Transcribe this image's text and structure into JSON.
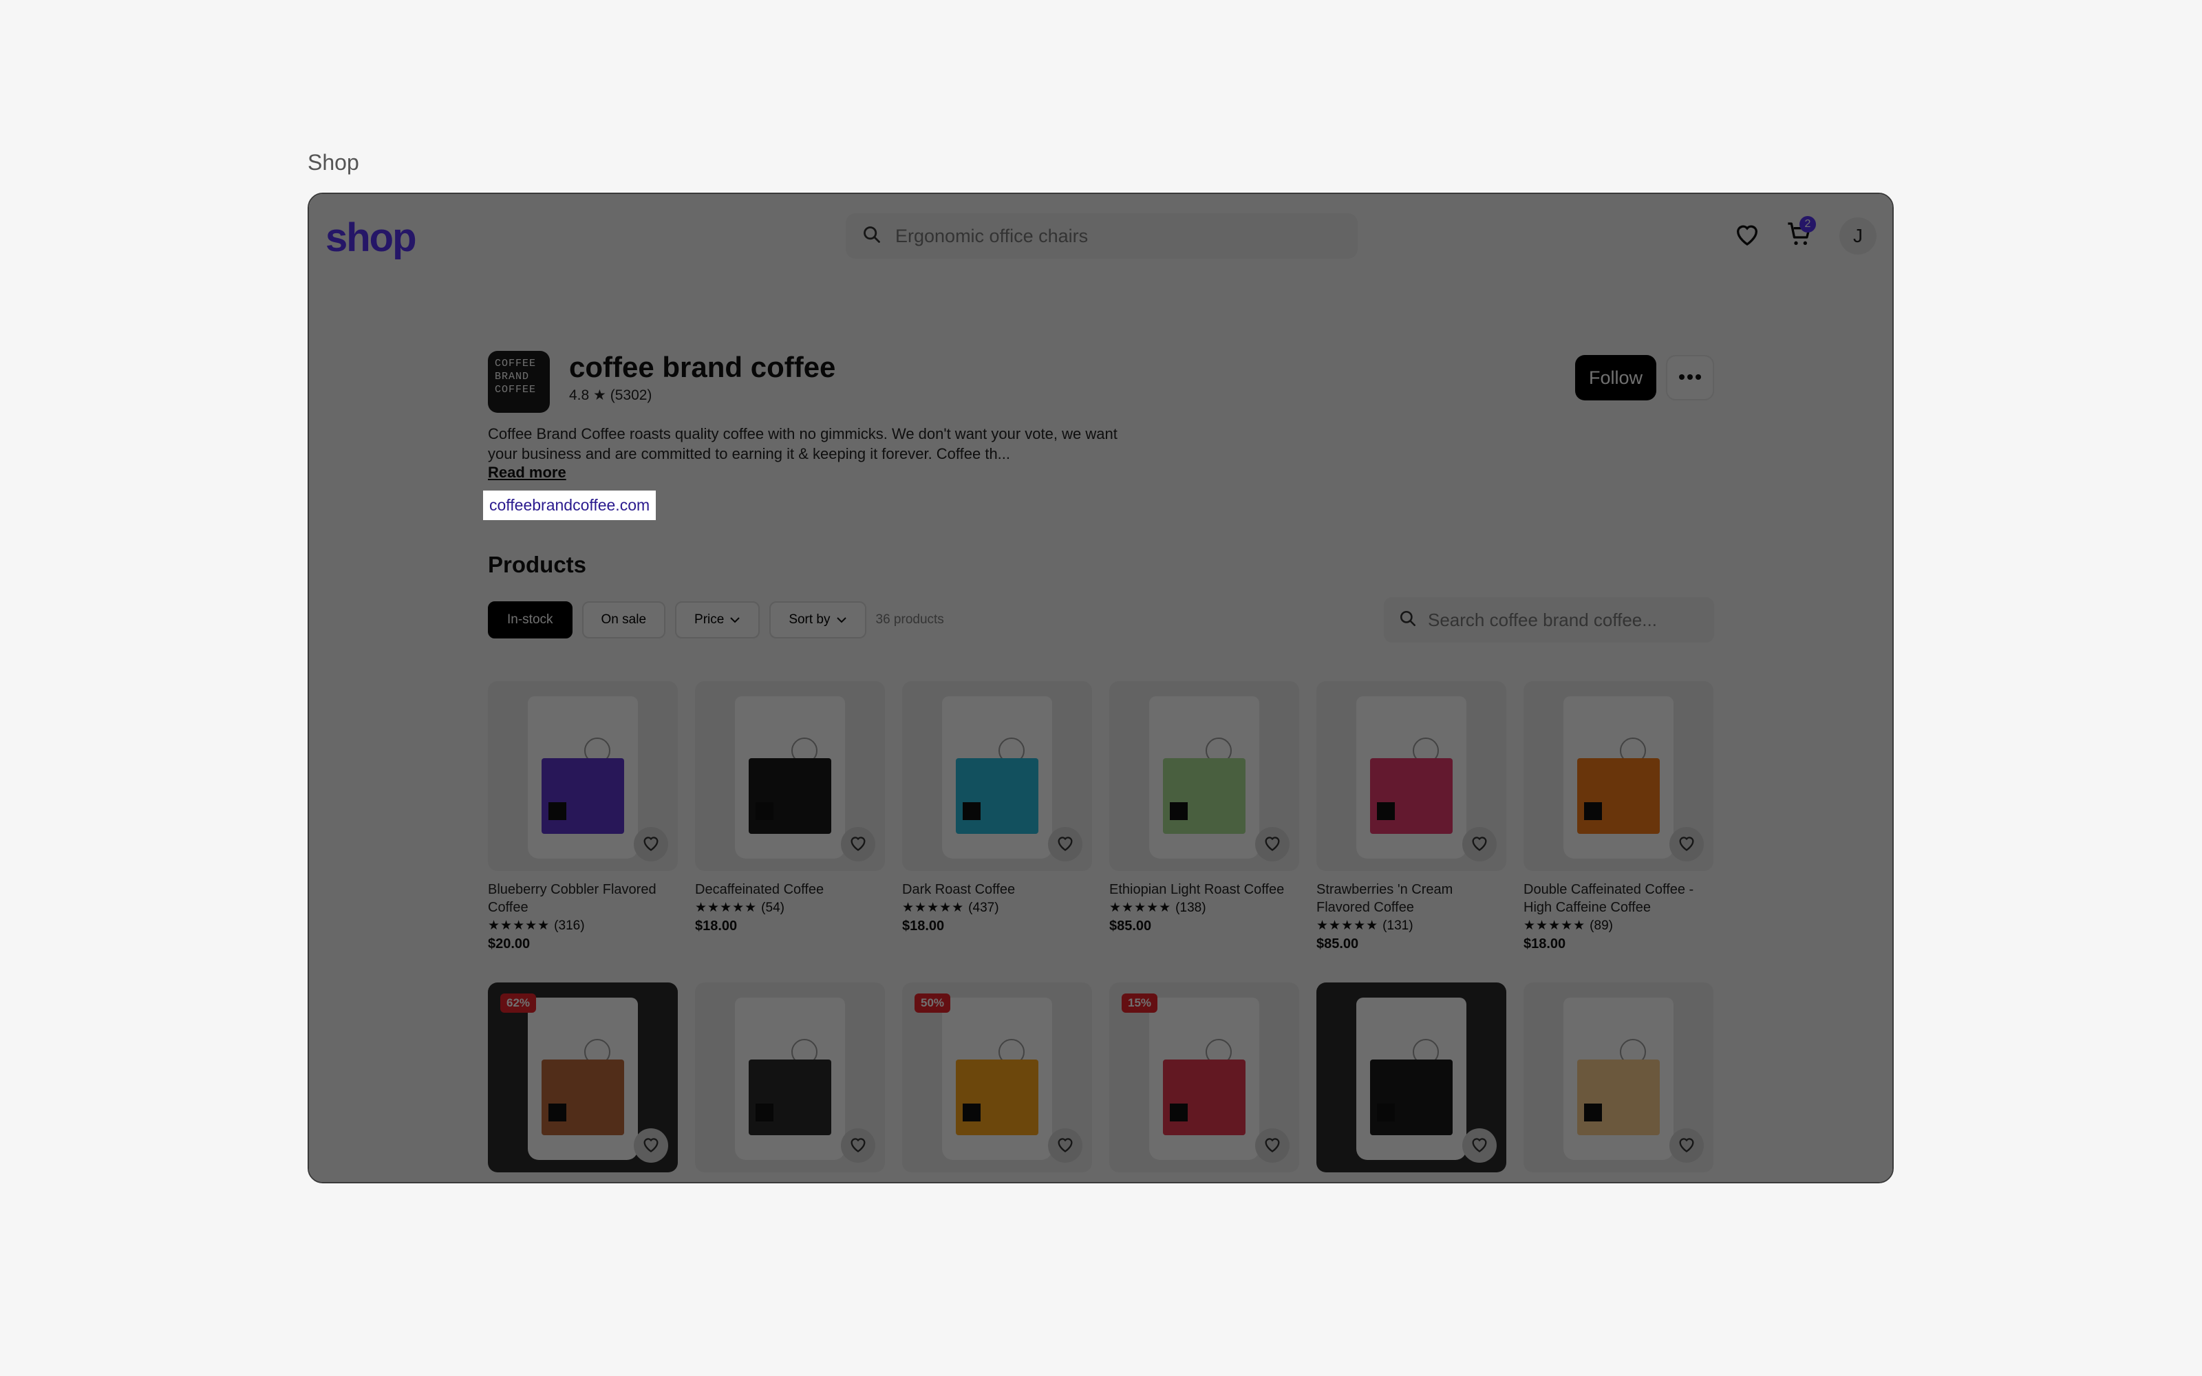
{
  "page_label": "Shop",
  "header": {
    "logo": "shop",
    "search_placeholder": "Ergonomic office chairs",
    "cart_count": "2",
    "avatar_initial": "J"
  },
  "store": {
    "logo_text": "COFFEE BRAND COFFEE",
    "name": "coffee brand coffee",
    "rating": "4.8",
    "reviews": "(5302)",
    "description": "Coffee Brand Coffee roasts quality coffee with no gimmicks. We don't want your vote, we want your business and are committed to earning it & keeping it forever. Coffee th...",
    "read_more": "Read more",
    "website": "coffeebrandcoffee.com",
    "follow_label": "Follow"
  },
  "products": {
    "title": "Products",
    "filters": {
      "in_stock": "In-stock",
      "on_sale": "On sale",
      "price": "Price",
      "sort_by": "Sort by",
      "count": "36 products"
    },
    "search_placeholder": "Search coffee brand coffee...",
    "items": [
      {
        "name": "Blueberry Cobbler Flavored Coffee",
        "stars": "★★★★★",
        "reviews": "(316)",
        "price": "$20.00",
        "panel_color": "#5b36c9"
      },
      {
        "name": "Decaffeinated Coffee",
        "stars": "★★★★★",
        "reviews": "(54)",
        "price": "$18.00",
        "panel_color": "#1a1a1a"
      },
      {
        "name": "Dark Roast Coffee",
        "stars": "★★★★★",
        "reviews": "(437)",
        "price": "$18.00",
        "panel_color": "#2bb6d6"
      },
      {
        "name": "Ethiopian Light Roast Coffee",
        "stars": "★★★★★",
        "reviews": "(138)",
        "price": "$85.00",
        "panel_color": "#a7d98f"
      },
      {
        "name": "Strawberries 'n Cream Flavored Coffee",
        "stars": "★★★★★",
        "reviews": "(131)",
        "price": "$85.00",
        "panel_color": "#e23a6c"
      },
      {
        "name": "Double Caffeinated Coffee - High Caffeine Coffee",
        "stars": "★★★★★",
        "reviews": "(89)",
        "price": "$18.00",
        "panel_color": "#f07a1a"
      }
    ],
    "row2": [
      {
        "badge": "62%",
        "panel_color": "#b8663a"
      },
      {
        "badge": "",
        "panel_color": "#2a2a2a"
      },
      {
        "badge": "50%",
        "panel_color": "#f5a31c"
      },
      {
        "badge": "15%",
        "panel_color": "#e0384e"
      },
      {
        "badge": "",
        "panel_color": "#1a1a1a"
      },
      {
        "badge": "",
        "panel_color": "#f3c98c"
      }
    ]
  }
}
